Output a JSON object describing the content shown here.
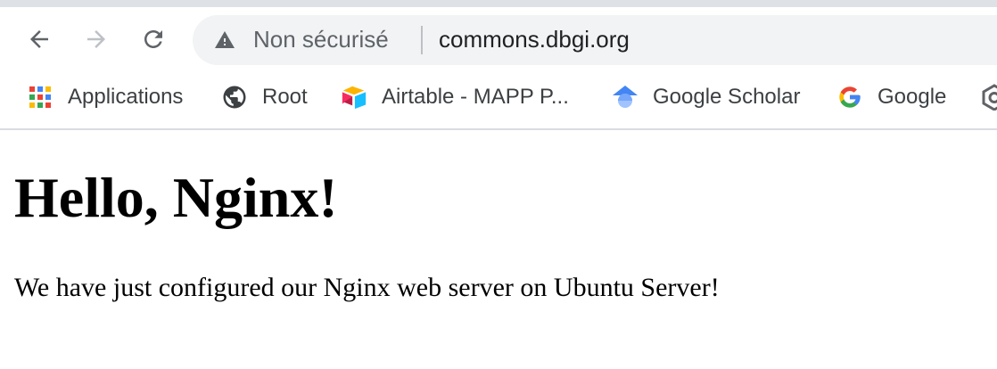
{
  "browser": {
    "nav": {
      "back_icon": "arrow-left-icon",
      "forward_icon": "arrow-right-icon",
      "reload_icon": "reload-icon"
    },
    "omnibox": {
      "security_icon": "warning-triangle-icon",
      "security_label": "Non sécurisé",
      "url": "commons.dbgi.org"
    },
    "bookmarks": [
      {
        "label": "Applications",
        "icon": "apps-grid-icon"
      },
      {
        "label": "Root",
        "icon": "globe-icon"
      },
      {
        "label": "Airtable - MAPP P...",
        "icon": "airtable-icon"
      },
      {
        "label": "Google Scholar",
        "icon": "google-scholar-icon"
      },
      {
        "label": "Google",
        "icon": "google-g-icon"
      }
    ],
    "colors": {
      "omnibox_bg": "#f1f3f4",
      "tab_strip": "#dee1e6",
      "icon_gray": "#5f6368"
    }
  },
  "page": {
    "heading": "Hello, Nginx!",
    "paragraph": "We have just configured our Nginx web server on Ubuntu Server!"
  }
}
